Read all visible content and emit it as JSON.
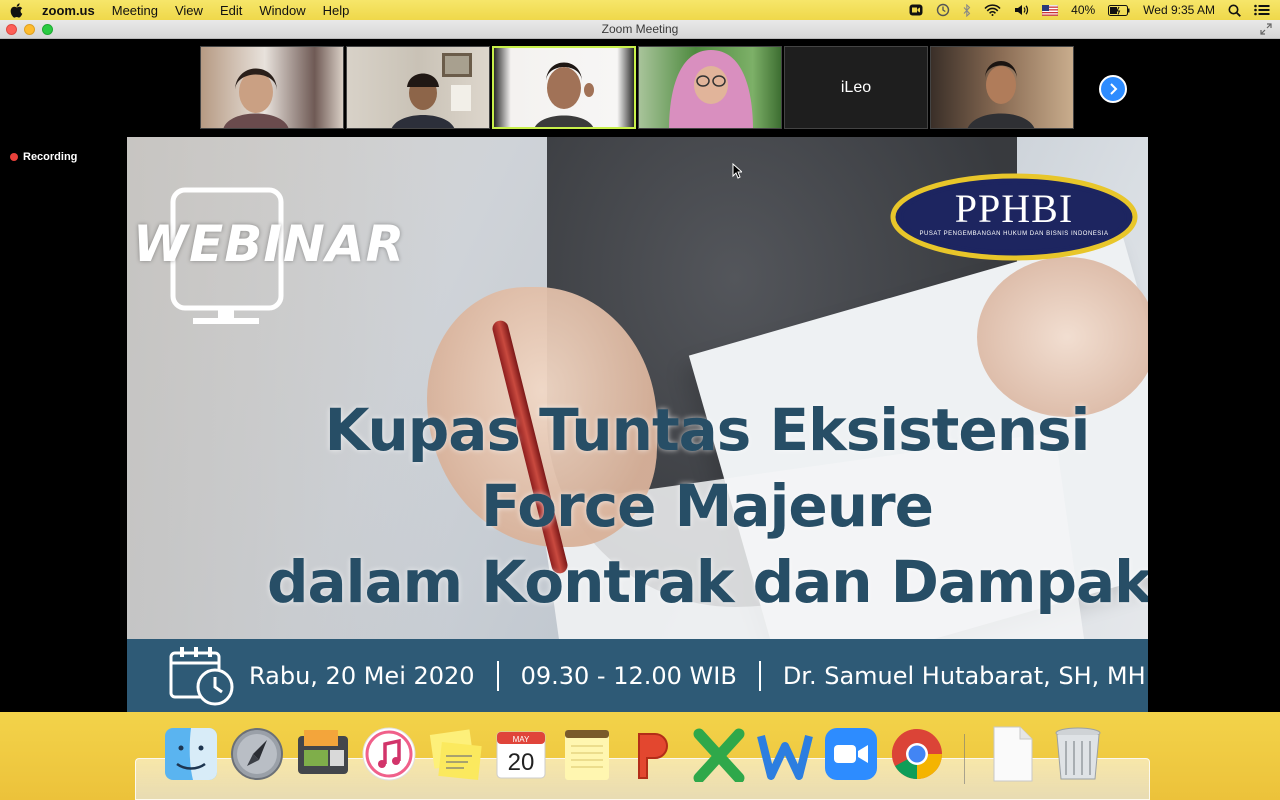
{
  "menubar": {
    "app_name": "zoom.us",
    "items": [
      "Meeting",
      "View",
      "Edit",
      "Window",
      "Help"
    ],
    "battery": "40%",
    "clock": "Wed 9:35 AM"
  },
  "window": {
    "title": "Zoom Meeting"
  },
  "participants": [
    {
      "name": "",
      "kind": "video"
    },
    {
      "name": "",
      "kind": "video"
    },
    {
      "name": "",
      "kind": "video",
      "active": true
    },
    {
      "name": "",
      "kind": "video"
    },
    {
      "name": "iLeo",
      "kind": "name-only"
    },
    {
      "name": "",
      "kind": "video"
    }
  ],
  "recording": {
    "label": "Recording"
  },
  "slide": {
    "badge": "WEBINAR",
    "logo_name": "PPHBI",
    "logo_sub": "PUSAT PENGEMBANGAN HUKUM DAN BISNIS INDONESIA",
    "headline": [
      "Kupas Tuntas Eksistensi",
      "Force Majeure",
      "dalam Kontrak dan Dampaknya"
    ],
    "date": "Rabu, 20 Mei 2020",
    "time": "09.30 - 12.00 WIB",
    "speaker": "Dr. Samuel Hutabarat, SH, MH"
  },
  "dock": {
    "calendar_month": "MAY",
    "calendar_day": "20",
    "apps": [
      "finder",
      "launchpad",
      "image-capture",
      "itunes",
      "stickies",
      "calendar",
      "notes",
      "powerpoint",
      "excel",
      "word",
      "zoom",
      "chrome",
      "document",
      "trash"
    ]
  },
  "colors": {
    "menubar": "#efd84a",
    "infobar": "#2e5a76",
    "headline": "#274e66",
    "zoom_blue": "#2d8cff"
  }
}
